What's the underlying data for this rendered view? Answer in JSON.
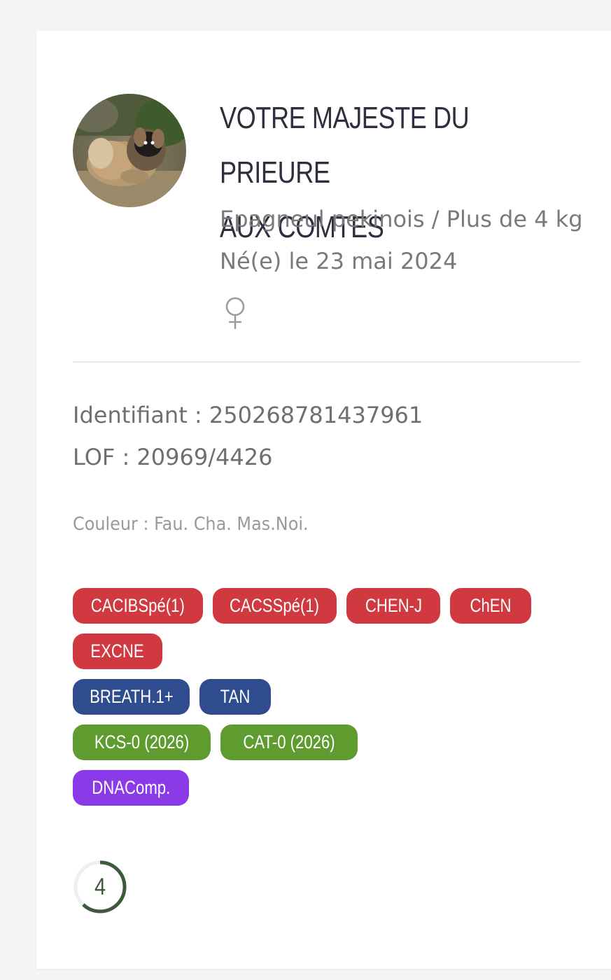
{
  "dog": {
    "name_line1": "VOTRE MAJESTE DU PRIEURE",
    "name_line2": "AUX COMTES",
    "breed": "Epagneul pekinois / Plus de 4 kg",
    "birth": "Né(e) le 23 mai 2024",
    "sex_icon": "female-icon",
    "identifier": "Identifiant : 250268781437961",
    "lof": "LOF : 20969/4426",
    "colour": "Couleur : Fau. Cha. Mas.Noi."
  },
  "badges": [
    [
      {
        "label": "CACIBSpé(1)",
        "color": "#d0393f",
        "width": 186
      },
      {
        "label": "CACSSpé(1)",
        "color": "#d0393f",
        "width": 177
      },
      {
        "label": "CHEN-J",
        "color": "#d0393f",
        "width": 134
      },
      {
        "label": "ChEN",
        "color": "#d0393f",
        "width": 116
      }
    ],
    [
      {
        "label": "EXCNE",
        "color": "#d0393f",
        "width": 128
      }
    ],
    [
      {
        "label": "BREATH.1+",
        "color": "#2f4d8e",
        "width": 167
      },
      {
        "label": "TAN",
        "color": "#2f4d8e",
        "width": 102
      }
    ],
    [
      {
        "label": "KCS-0 (2026)",
        "color": "#5f9c2f",
        "width": 197
      },
      {
        "label": "CAT-0 (2026)",
        "color": "#5f9c2f",
        "width": 196
      }
    ],
    [
      {
        "label": "DNAComp.",
        "color": "#8b3ae8",
        "width": 166
      }
    ]
  ],
  "score": {
    "value": "4",
    "progress": 0.62,
    "ring_color": "#3d5a3b",
    "track_color": "#efefef"
  }
}
